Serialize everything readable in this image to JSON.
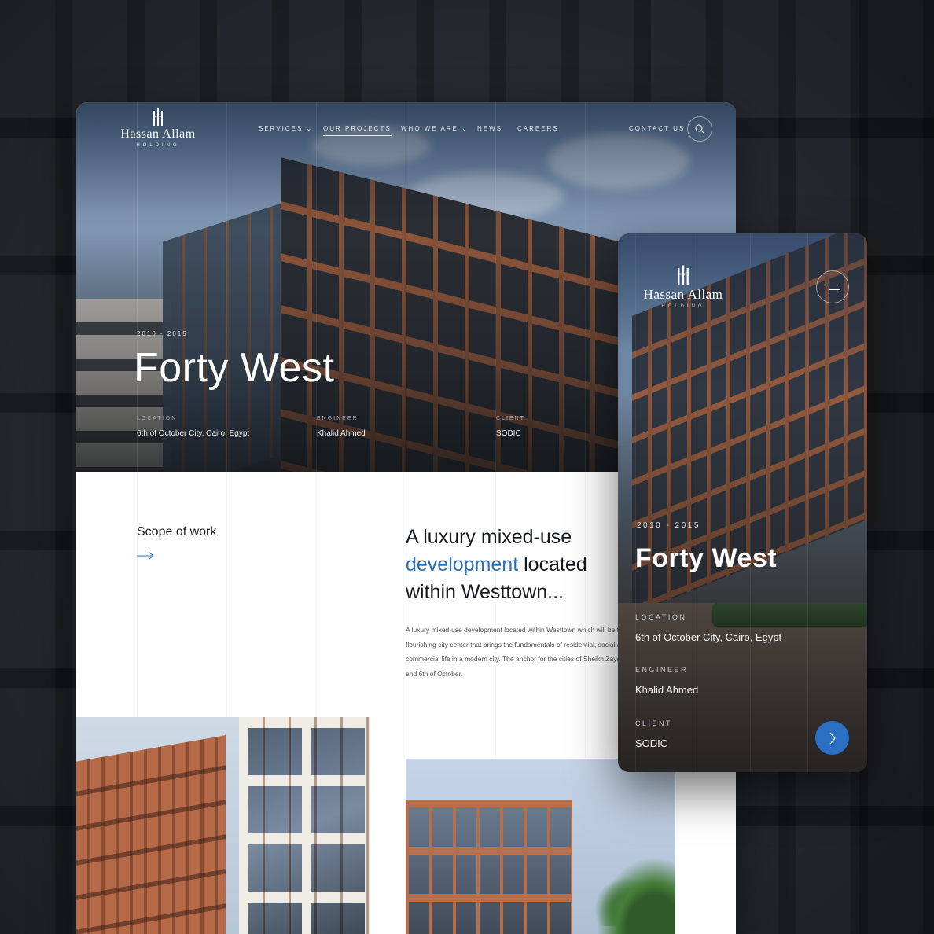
{
  "brand": {
    "name": "Hassan Allam",
    "sub": "HOLDING"
  },
  "nav": {
    "items": [
      {
        "label": "SERVICES",
        "dropdown": true
      },
      {
        "label": "OUR PROJECTS",
        "active": true
      },
      {
        "label": "WHO WE ARE",
        "dropdown": true
      },
      {
        "label": "NEWS"
      },
      {
        "label": "CAREERS"
      }
    ],
    "contact": "CONTACT US",
    "search_icon": "search-icon"
  },
  "project": {
    "years": "2010 - 2015",
    "title": "Forty West",
    "meta": [
      {
        "label": "LOCATION",
        "value": "6th of October City, Cairo, Egypt"
      },
      {
        "label": "ENGINEER",
        "value": "Khalid Ahmed"
      },
      {
        "label": "CLIENT",
        "value": "SODIC"
      }
    ]
  },
  "content": {
    "scope_label": "Scope of work",
    "headline_part1": "A luxury mixed-use",
    "headline_accent": "development",
    "headline_part2": "located within Westtown...",
    "body": "A luxury mixed-use development located within Westtown which will be the flourishing city center that brings the fundamentals of residential, social and commercial life in a modern city. The anchor for the cities of Sheikh Zayed and 6th of October."
  },
  "mobile": {
    "menu_icon": "hamburger-icon",
    "next_icon": "chevron-right-icon"
  },
  "colors": {
    "accent": "#2d6fb6",
    "button_blue": "#2b6fc3",
    "text_dark": "#141821"
  }
}
